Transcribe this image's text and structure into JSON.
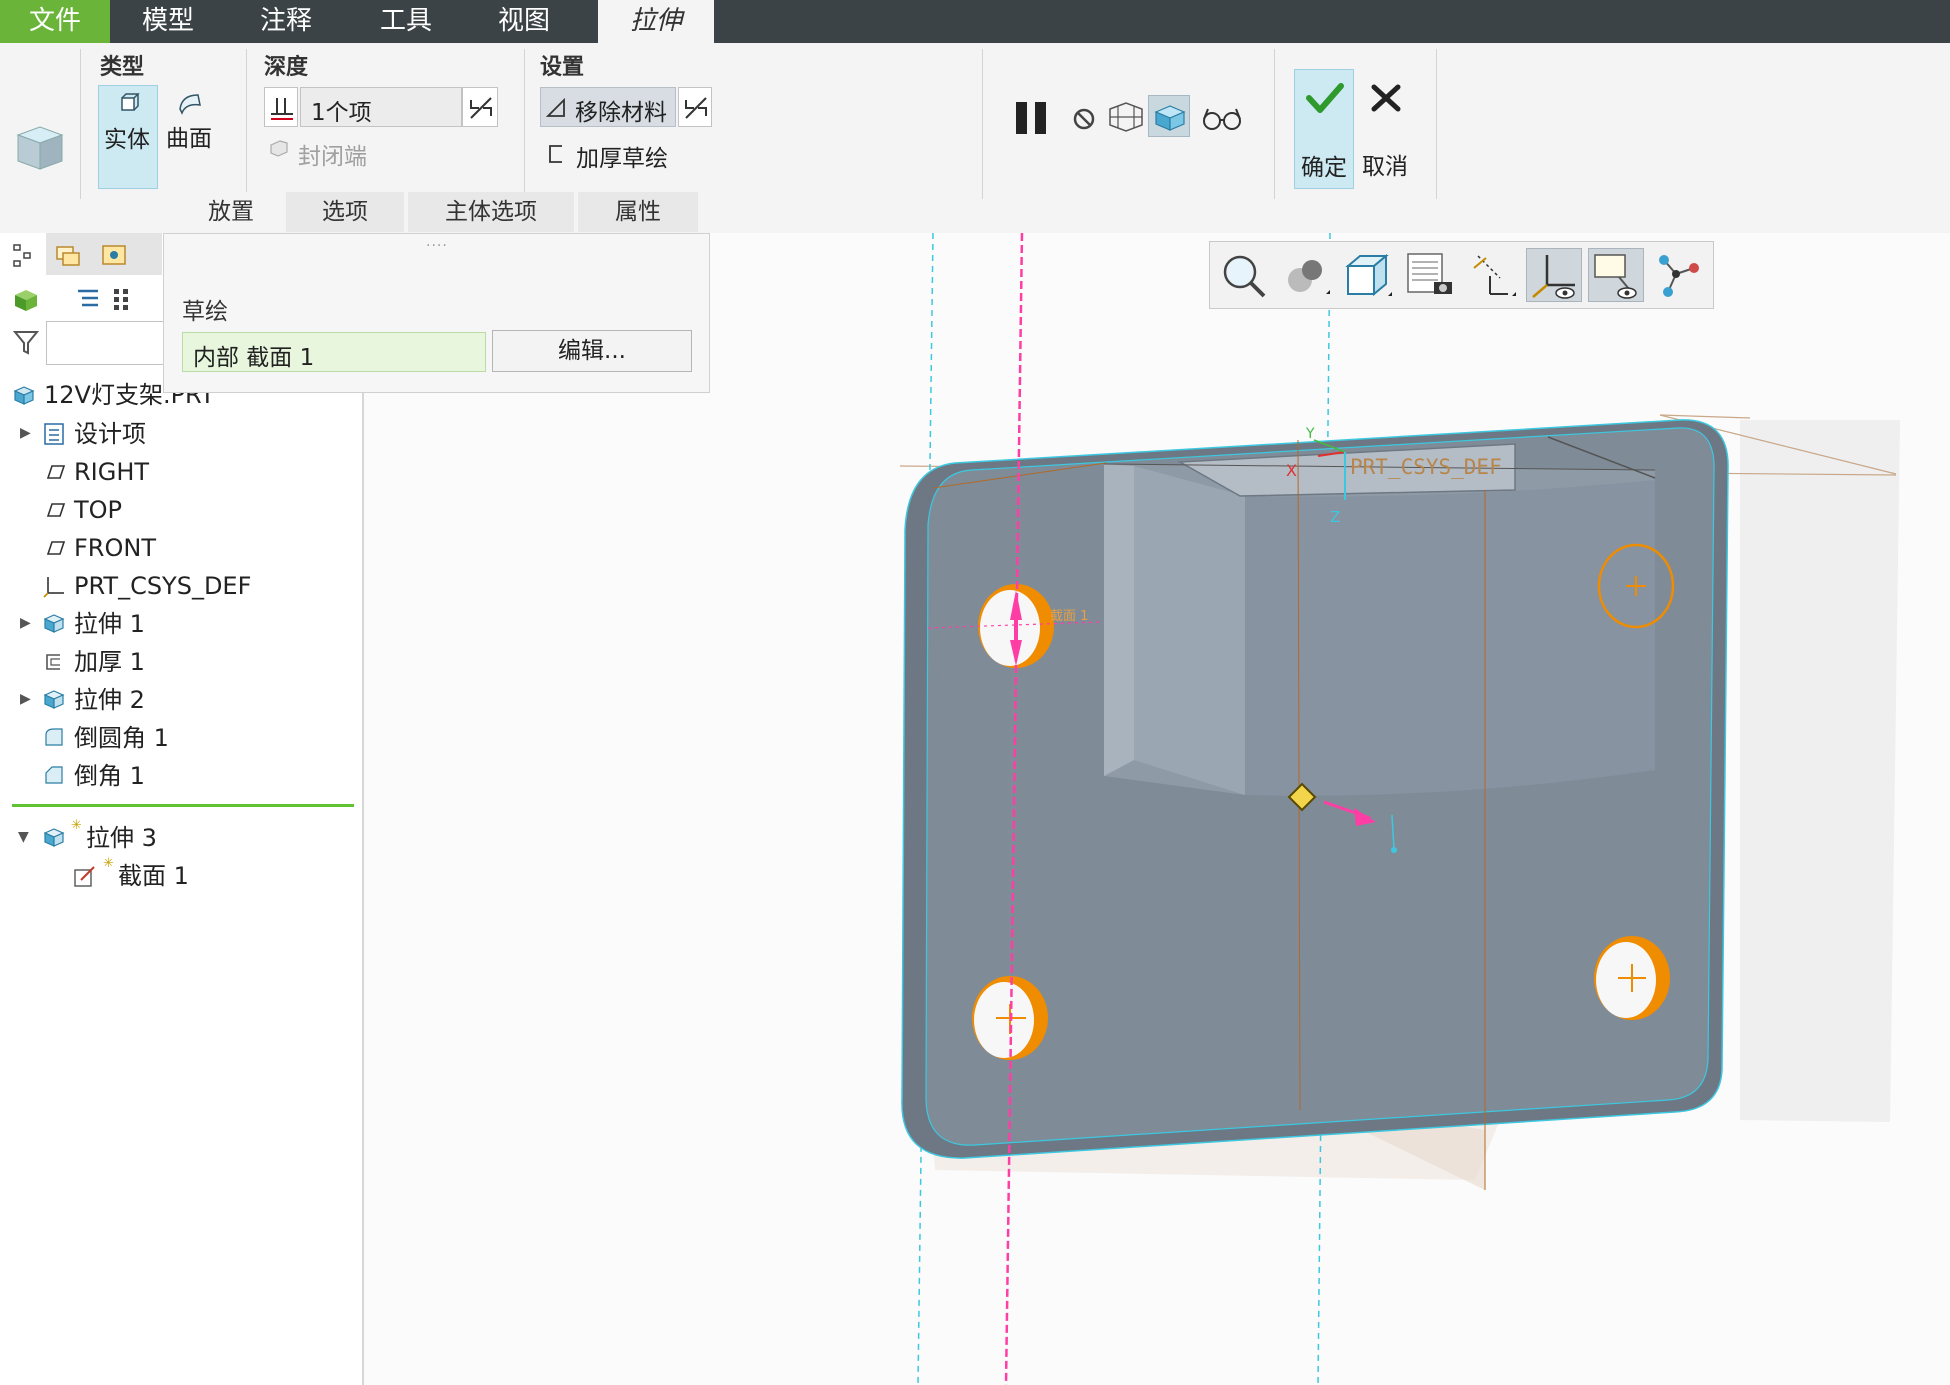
{
  "menu": {
    "file": "文件",
    "model": "模型",
    "annotate": "注释",
    "tools": "工具",
    "view": "视图",
    "extrude": "拉伸"
  },
  "ribbon": {
    "type_group": {
      "title": "类型",
      "solid": "实体",
      "surface": "曲面"
    },
    "depth_group": {
      "title": "深度",
      "value": "1个项",
      "capped_ends": "封闭端"
    },
    "settings_group": {
      "title": "设置",
      "remove_material": "移除材料",
      "thicken_sketch": "加厚草绘"
    },
    "ok": "确定",
    "cancel": "取消"
  },
  "tabs": [
    {
      "label": "放置",
      "selected": true
    },
    {
      "label": "选项",
      "selected": false
    },
    {
      "label": "主体选项",
      "selected": false
    },
    {
      "label": "属性",
      "selected": false
    }
  ],
  "placement_panel": {
    "grip": "....",
    "sketch_label": "草绘",
    "sketch_value": "内部 截面 1",
    "edit_button": "编辑..."
  },
  "model_tree": {
    "root": "12V灯支架.PRT",
    "items": [
      {
        "label": "设计项",
        "icon": "design-items-icon",
        "expandable": true
      },
      {
        "label": "RIGHT",
        "icon": "datum-plane-icon",
        "expandable": false
      },
      {
        "label": "TOP",
        "icon": "datum-plane-icon",
        "expandable": false
      },
      {
        "label": "FRONT",
        "icon": "datum-plane-icon",
        "expandable": false
      },
      {
        "label": "PRT_CSYS_DEF",
        "icon": "csys-icon",
        "expandable": false
      },
      {
        "label": "拉伸 1",
        "icon": "extrude-icon",
        "expandable": true
      },
      {
        "label": "加厚 1",
        "icon": "thicken-icon",
        "expandable": false
      },
      {
        "label": "拉伸 2",
        "icon": "extrude-icon",
        "expandable": true
      },
      {
        "label": "倒圆角 1",
        "icon": "round-icon",
        "expandable": false
      },
      {
        "label": "倒角 1",
        "icon": "chamfer-icon",
        "expandable": false
      }
    ],
    "insert_here": "insert-indicator",
    "active_feature": {
      "label": "拉伸 3",
      "icon": "extrude-icon"
    },
    "active_child": {
      "label": "截面 1",
      "icon": "sketch-icon"
    }
  },
  "viewport": {
    "csys_label": "PRT_CSYS_DEF",
    "section_label": "截面 1",
    "axis_x": "X",
    "axis_y": "Y",
    "axis_z": "Z"
  },
  "colors": {
    "menu_bg": "#3c4346",
    "file_green": "#6ab539",
    "part_gray": "#7f8b97",
    "hole_orange": "#f08c00",
    "datum_cyan": "#3cc8e0",
    "drag_pink": "#ff3ea5"
  }
}
